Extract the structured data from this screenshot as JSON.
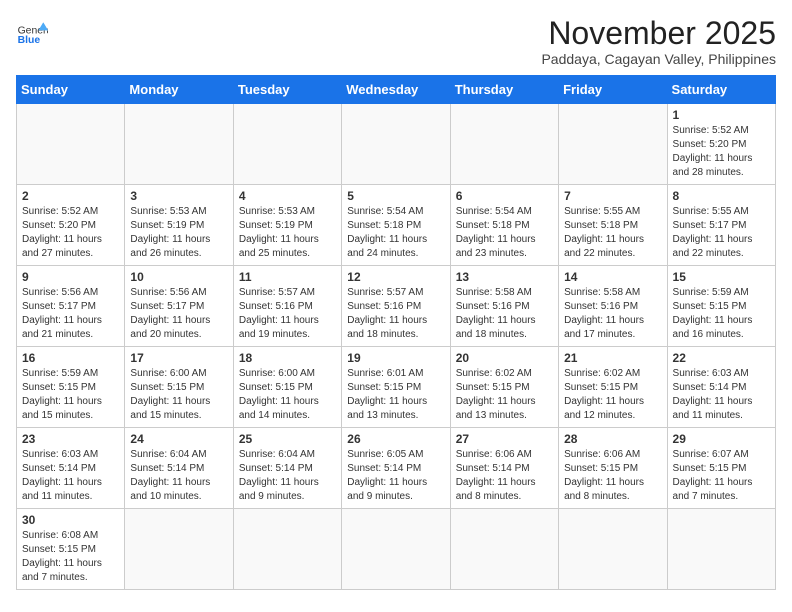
{
  "header": {
    "logo_line1": "General",
    "logo_line2": "Blue",
    "month_title": "November 2025",
    "subtitle": "Paddaya, Cagayan Valley, Philippines"
  },
  "weekdays": [
    "Sunday",
    "Monday",
    "Tuesday",
    "Wednesday",
    "Thursday",
    "Friday",
    "Saturday"
  ],
  "weeks": [
    [
      {
        "day": "",
        "info": ""
      },
      {
        "day": "",
        "info": ""
      },
      {
        "day": "",
        "info": ""
      },
      {
        "day": "",
        "info": ""
      },
      {
        "day": "",
        "info": ""
      },
      {
        "day": "",
        "info": ""
      },
      {
        "day": "1",
        "info": "Sunrise: 5:52 AM\nSunset: 5:20 PM\nDaylight: 11 hours\nand 28 minutes."
      }
    ],
    [
      {
        "day": "2",
        "info": "Sunrise: 5:52 AM\nSunset: 5:20 PM\nDaylight: 11 hours\nand 27 minutes."
      },
      {
        "day": "3",
        "info": "Sunrise: 5:53 AM\nSunset: 5:19 PM\nDaylight: 11 hours\nand 26 minutes."
      },
      {
        "day": "4",
        "info": "Sunrise: 5:53 AM\nSunset: 5:19 PM\nDaylight: 11 hours\nand 25 minutes."
      },
      {
        "day": "5",
        "info": "Sunrise: 5:54 AM\nSunset: 5:18 PM\nDaylight: 11 hours\nand 24 minutes."
      },
      {
        "day": "6",
        "info": "Sunrise: 5:54 AM\nSunset: 5:18 PM\nDaylight: 11 hours\nand 23 minutes."
      },
      {
        "day": "7",
        "info": "Sunrise: 5:55 AM\nSunset: 5:18 PM\nDaylight: 11 hours\nand 22 minutes."
      },
      {
        "day": "8",
        "info": "Sunrise: 5:55 AM\nSunset: 5:17 PM\nDaylight: 11 hours\nand 22 minutes."
      }
    ],
    [
      {
        "day": "9",
        "info": "Sunrise: 5:56 AM\nSunset: 5:17 PM\nDaylight: 11 hours\nand 21 minutes."
      },
      {
        "day": "10",
        "info": "Sunrise: 5:56 AM\nSunset: 5:17 PM\nDaylight: 11 hours\nand 20 minutes."
      },
      {
        "day": "11",
        "info": "Sunrise: 5:57 AM\nSunset: 5:16 PM\nDaylight: 11 hours\nand 19 minutes."
      },
      {
        "day": "12",
        "info": "Sunrise: 5:57 AM\nSunset: 5:16 PM\nDaylight: 11 hours\nand 18 minutes."
      },
      {
        "day": "13",
        "info": "Sunrise: 5:58 AM\nSunset: 5:16 PM\nDaylight: 11 hours\nand 18 minutes."
      },
      {
        "day": "14",
        "info": "Sunrise: 5:58 AM\nSunset: 5:16 PM\nDaylight: 11 hours\nand 17 minutes."
      },
      {
        "day": "15",
        "info": "Sunrise: 5:59 AM\nSunset: 5:15 PM\nDaylight: 11 hours\nand 16 minutes."
      }
    ],
    [
      {
        "day": "16",
        "info": "Sunrise: 5:59 AM\nSunset: 5:15 PM\nDaylight: 11 hours\nand 15 minutes."
      },
      {
        "day": "17",
        "info": "Sunrise: 6:00 AM\nSunset: 5:15 PM\nDaylight: 11 hours\nand 15 minutes."
      },
      {
        "day": "18",
        "info": "Sunrise: 6:00 AM\nSunset: 5:15 PM\nDaylight: 11 hours\nand 14 minutes."
      },
      {
        "day": "19",
        "info": "Sunrise: 6:01 AM\nSunset: 5:15 PM\nDaylight: 11 hours\nand 13 minutes."
      },
      {
        "day": "20",
        "info": "Sunrise: 6:02 AM\nSunset: 5:15 PM\nDaylight: 11 hours\nand 13 minutes."
      },
      {
        "day": "21",
        "info": "Sunrise: 6:02 AM\nSunset: 5:15 PM\nDaylight: 11 hours\nand 12 minutes."
      },
      {
        "day": "22",
        "info": "Sunrise: 6:03 AM\nSunset: 5:14 PM\nDaylight: 11 hours\nand 11 minutes."
      }
    ],
    [
      {
        "day": "23",
        "info": "Sunrise: 6:03 AM\nSunset: 5:14 PM\nDaylight: 11 hours\nand 11 minutes."
      },
      {
        "day": "24",
        "info": "Sunrise: 6:04 AM\nSunset: 5:14 PM\nDaylight: 11 hours\nand 10 minutes."
      },
      {
        "day": "25",
        "info": "Sunrise: 6:04 AM\nSunset: 5:14 PM\nDaylight: 11 hours\nand 9 minutes."
      },
      {
        "day": "26",
        "info": "Sunrise: 6:05 AM\nSunset: 5:14 PM\nDaylight: 11 hours\nand 9 minutes."
      },
      {
        "day": "27",
        "info": "Sunrise: 6:06 AM\nSunset: 5:14 PM\nDaylight: 11 hours\nand 8 minutes."
      },
      {
        "day": "28",
        "info": "Sunrise: 6:06 AM\nSunset: 5:15 PM\nDaylight: 11 hours\nand 8 minutes."
      },
      {
        "day": "29",
        "info": "Sunrise: 6:07 AM\nSunset: 5:15 PM\nDaylight: 11 hours\nand 7 minutes."
      }
    ],
    [
      {
        "day": "30",
        "info": "Sunrise: 6:08 AM\nSunset: 5:15 PM\nDaylight: 11 hours\nand 7 minutes."
      },
      {
        "day": "",
        "info": ""
      },
      {
        "day": "",
        "info": ""
      },
      {
        "day": "",
        "info": ""
      },
      {
        "day": "",
        "info": ""
      },
      {
        "day": "",
        "info": ""
      },
      {
        "day": "",
        "info": ""
      }
    ]
  ]
}
